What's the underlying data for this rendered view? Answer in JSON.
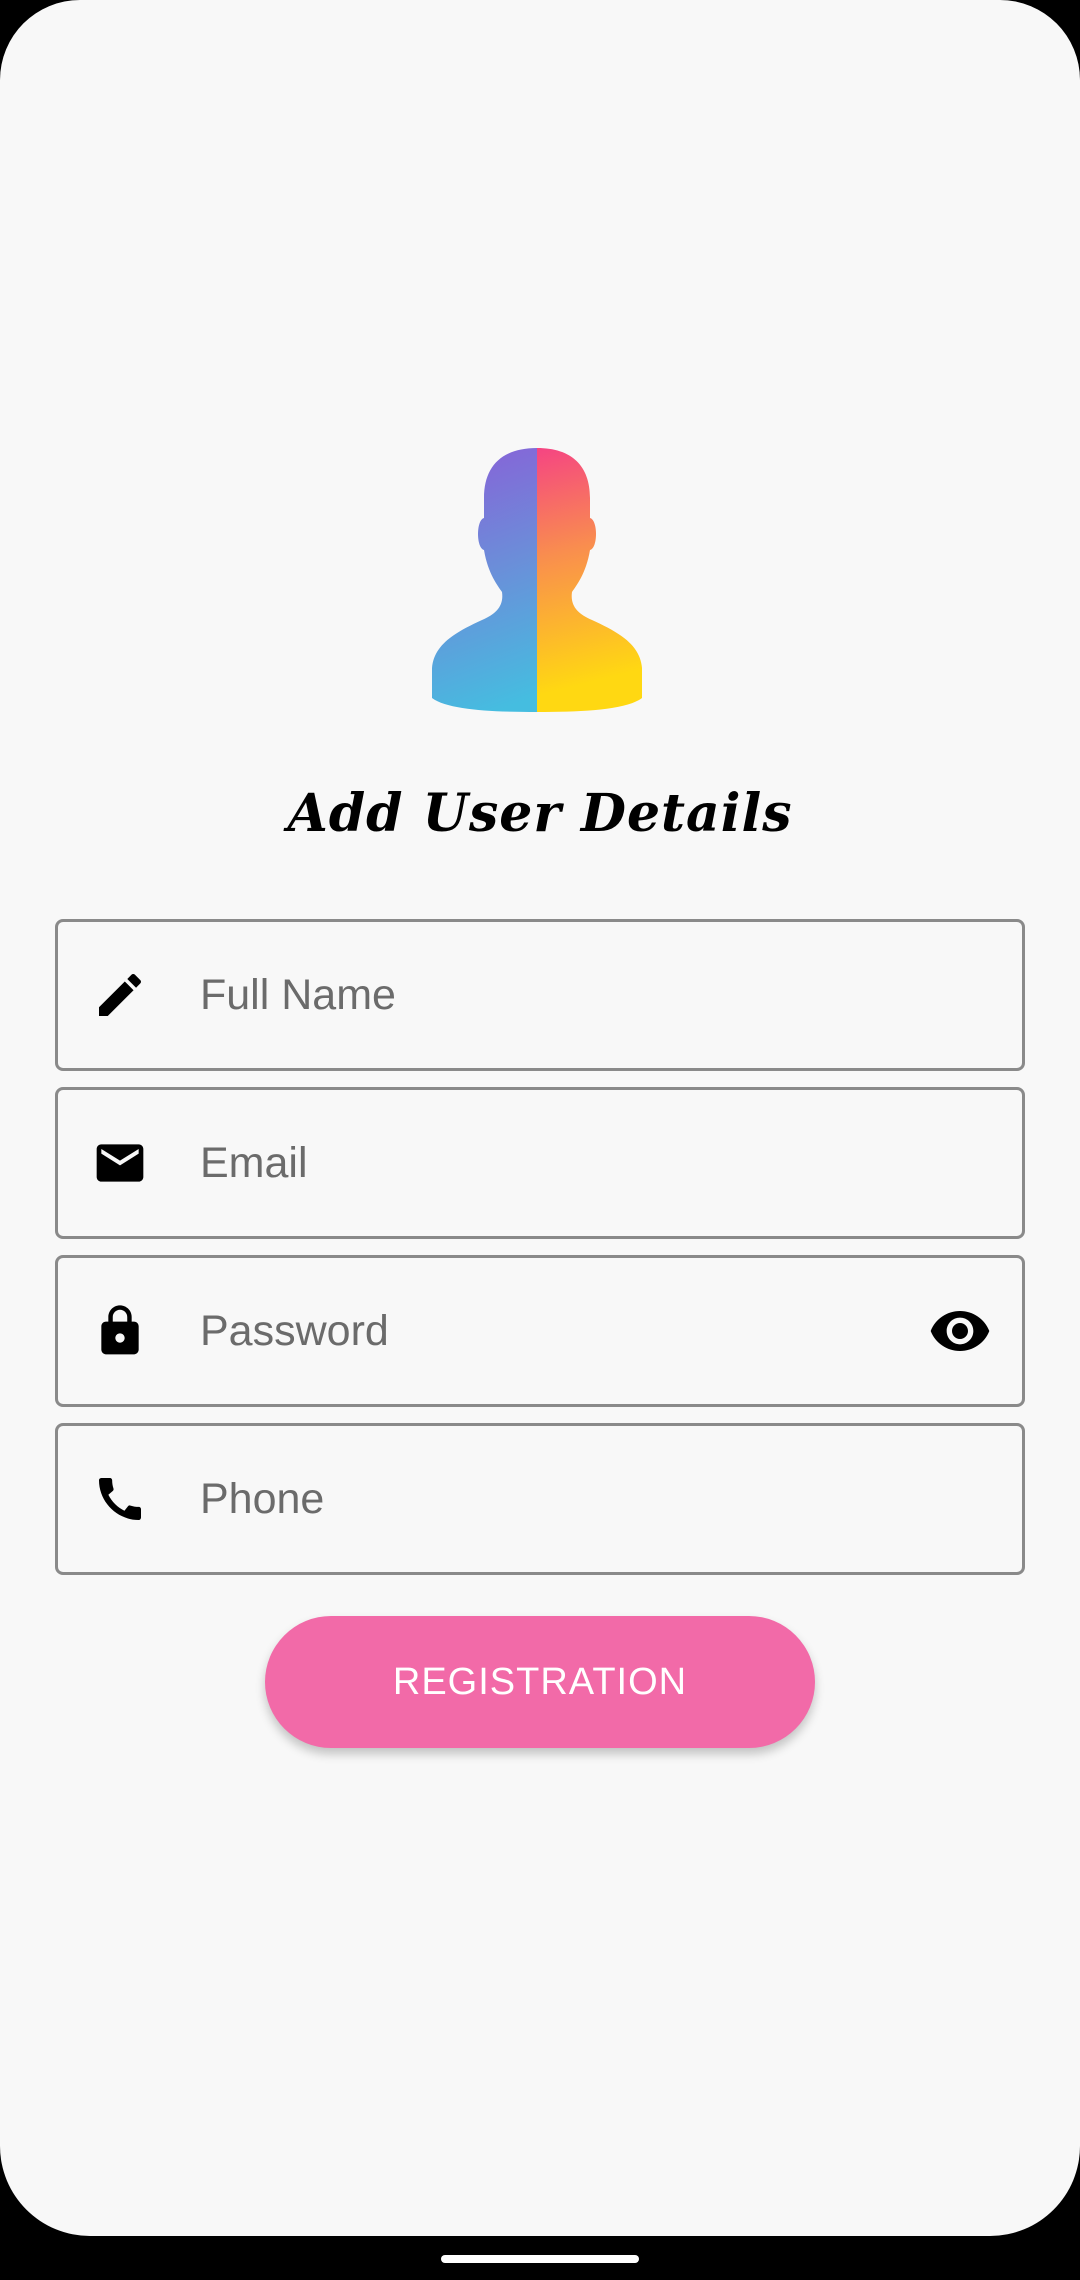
{
  "screen": {
    "title": "Add User Details"
  },
  "form": {
    "full_name": {
      "placeholder": "Full Name",
      "icon": "pencil-icon"
    },
    "email": {
      "placeholder": "Email",
      "icon": "envelope-icon"
    },
    "password": {
      "placeholder": "Password",
      "icon": "lock-icon",
      "toggle_icon": "eye-icon"
    },
    "phone": {
      "placeholder": "Phone",
      "icon": "phone-icon"
    }
  },
  "actions": {
    "register_label": "REGISTRATION"
  },
  "colors": {
    "background": "#f8f8f8",
    "accent": "#f26aa8",
    "field_border": "#8a8a8a",
    "placeholder_text": "#6b6b6b"
  }
}
